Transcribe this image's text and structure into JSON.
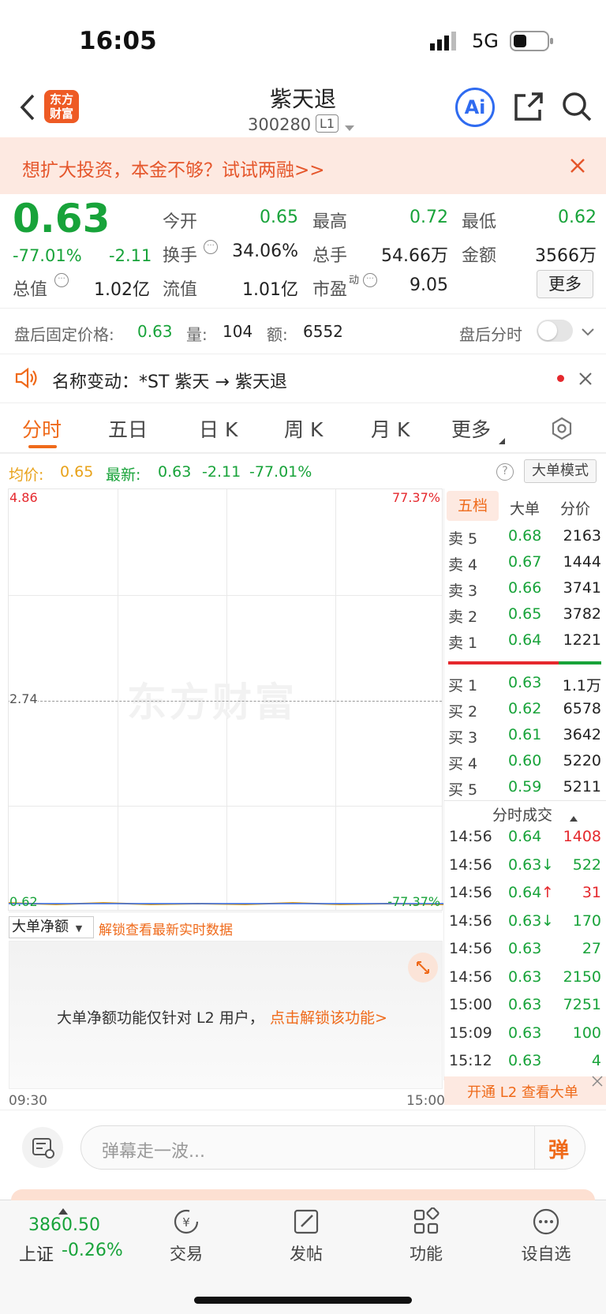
{
  "status": {
    "time": "16:05",
    "network": "5G"
  },
  "header": {
    "title": "紫天退",
    "code": "300280",
    "level": "L1",
    "logo_text": "东方财富",
    "ai_label": "Ai"
  },
  "banner": {
    "text": "想扩大投资，本金不够？试试两融>>"
  },
  "quote": {
    "price": "0.63",
    "change_pct": "-77.01%",
    "change": "-2.11",
    "open_label": "今开",
    "open": "0.65",
    "high_label": "最高",
    "high": "0.72",
    "low_label": "最低",
    "low": "0.62",
    "turnover_label": "换手",
    "turnover": "34.06%",
    "volume_label": "总手",
    "volume": "54.66万",
    "amount_label": "金额",
    "amount": "3566万",
    "mcap_label": "总值",
    "mcap": "1.02亿",
    "float_label": "流值",
    "float": "1.01亿",
    "pe_label": "市盈",
    "pe_sup": "动",
    "pe": "9.05",
    "more": "更多"
  },
  "after_hours": {
    "label": "盘后固定价格:",
    "price": "0.63",
    "vol_label": "量:",
    "vol": "104",
    "amt_label": "额:",
    "amt": "6552",
    "toggle_label": "盘后分时"
  },
  "notice": {
    "text": "名称变动：*ST 紫天 → 紫天退"
  },
  "tabs": [
    "分时",
    "五日",
    "日 K",
    "周 K",
    "月 K",
    "更多"
  ],
  "summary": {
    "avg_label": "均价:",
    "avg": "0.65",
    "latest_label": "最新:",
    "latest": "0.63",
    "change": "-2.11",
    "pct": "-77.01%",
    "mode": "大单模式"
  },
  "chart": {
    "top_left": "4.86",
    "top_right": "77.37%",
    "mid_left": "2.74",
    "bottom_left": "0.62",
    "bottom_right": "-77.37%",
    "watermark": "东方财富",
    "start_time": "09:30",
    "end_time": "15:00"
  },
  "bigorder": {
    "label": "大单净额",
    "unlock": "解锁查看最新实时数据",
    "msg": "大单净额功能仅针对 L2 用户，",
    "link": "点击解锁该功能>"
  },
  "orderbook": {
    "tabs": [
      "五档",
      "大单",
      "分价"
    ],
    "sells": [
      {
        "label": "卖 5",
        "price": "0.68",
        "vol": "2163"
      },
      {
        "label": "卖 4",
        "price": "0.67",
        "vol": "1444"
      },
      {
        "label": "卖 3",
        "price": "0.66",
        "vol": "3741"
      },
      {
        "label": "卖 2",
        "price": "0.65",
        "vol": "3782"
      },
      {
        "label": "卖 1",
        "price": "0.64",
        "vol": "1221"
      }
    ],
    "buys": [
      {
        "label": "买 1",
        "price": "0.63",
        "vol": "1.1万"
      },
      {
        "label": "买 2",
        "price": "0.62",
        "vol": "6578"
      },
      {
        "label": "买 3",
        "price": "0.61",
        "vol": "3642"
      },
      {
        "label": "买 4",
        "price": "0.60",
        "vol": "5220"
      },
      {
        "label": "买 5",
        "price": "0.59",
        "vol": "5211"
      }
    ],
    "trades_title": "分时成交",
    "trades": [
      {
        "time": "14:56",
        "price": "0.64",
        "arrow": "",
        "vol": "1408",
        "color": "#e5282d"
      },
      {
        "time": "14:56",
        "price": "0.63",
        "arrow": "↓",
        "vol": "522",
        "color": "#18a33a"
      },
      {
        "time": "14:56",
        "price": "0.64",
        "arrow": "↑",
        "vol": "31",
        "color": "#e5282d"
      },
      {
        "time": "14:56",
        "price": "0.63",
        "arrow": "↓",
        "vol": "170",
        "color": "#18a33a"
      },
      {
        "time": "14:56",
        "price": "0.63",
        "arrow": "",
        "vol": "27",
        "color": "#18a33a"
      },
      {
        "time": "14:56",
        "price": "0.63",
        "arrow": "",
        "vol": "2150",
        "color": "#18a33a"
      },
      {
        "time": "15:00",
        "price": "0.63",
        "arrow": "",
        "vol": "7251",
        "color": "#18a33a"
      },
      {
        "time": "15:09",
        "price": "0.63",
        "arrow": "",
        "vol": "100",
        "color": "#18a33a"
      },
      {
        "time": "15:12",
        "price": "0.63",
        "arrow": "",
        "vol": "4",
        "color": "#18a33a"
      }
    ],
    "l2_promo": "开通 L2 查看大单"
  },
  "comment": {
    "placeholder": "弹幕走一波...",
    "danmu": "弹"
  },
  "bottom": {
    "index_value": "3860.50",
    "index_name": "上证",
    "index_pct": "-0.26%",
    "nav": [
      "交易",
      "发帖",
      "功能",
      "设自选"
    ]
  }
}
